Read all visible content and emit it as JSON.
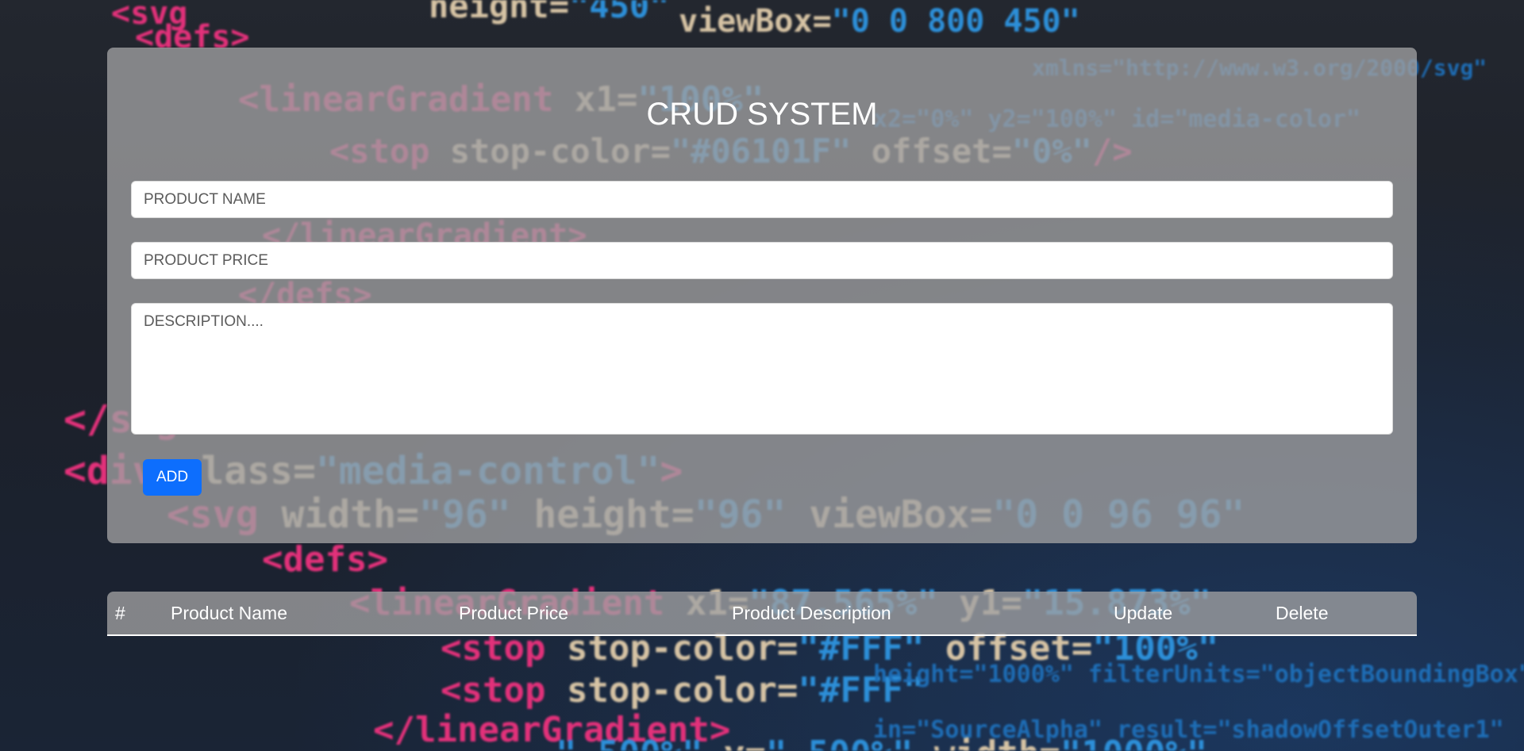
{
  "page": {
    "title": "CRUD SYSTEM"
  },
  "form": {
    "product_name": {
      "value": "",
      "placeholder": "PRODUCT NAME"
    },
    "product_price": {
      "value": "",
      "placeholder": "PRODUCT PRICE"
    },
    "description": {
      "value": "",
      "placeholder": "DESCRIPTION...."
    },
    "add_label": "ADD"
  },
  "table": {
    "headers": [
      "#",
      "Product Name",
      "Product Price",
      "Product Description",
      "Update",
      "Delete"
    ],
    "rows": []
  },
  "colors": {
    "accent": "#0d6efd",
    "card_background": "#a0a0a2",
    "text_on_card": "#ffffff"
  }
}
